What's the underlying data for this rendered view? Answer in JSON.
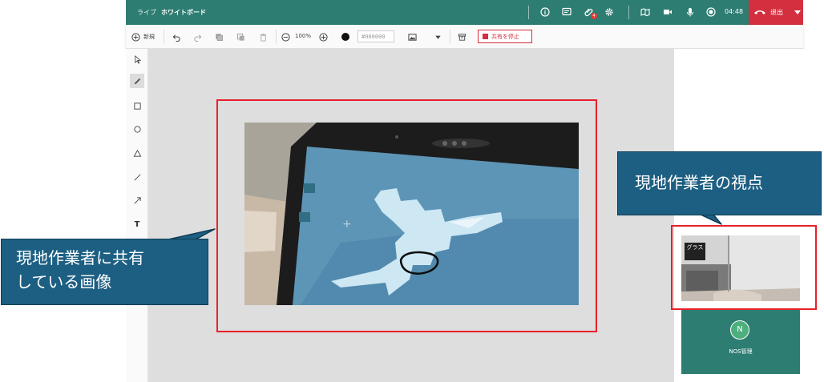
{
  "topbar": {
    "live_label": "ライブ",
    "whiteboard_label": "ホワイトボード",
    "badge_count": "4",
    "time": "04:48",
    "leave_label": "退出",
    "bg_color": "#2e7d72",
    "leave_color": "#d32f3f",
    "icons": [
      "info-icon",
      "chat-icon",
      "attachment-icon",
      "settings-icon",
      "map-icon",
      "video-icon",
      "microphone-icon",
      "record-icon",
      "hangup-icon",
      "chevron-down-icon"
    ]
  },
  "toolbar": {
    "new_label": "新規",
    "zoom_label": "100%",
    "color_value": "#000000",
    "stop_share_label": "共有を停止",
    "icons": [
      "add-circle-icon",
      "undo-icon",
      "redo-icon",
      "copy-icon",
      "duplicate-icon",
      "delete-icon",
      "zoom-out-icon",
      "zoom-in-icon",
      "image-icon",
      "caret-down-icon",
      "archive-icon"
    ]
  },
  "palette": {
    "text_tool_label": "T",
    "icons": [
      "select-cursor-icon",
      "pen-icon",
      "rectangle-icon",
      "circle-icon",
      "triangle-icon",
      "line-icon",
      "arrow-icon",
      "text-icon"
    ]
  },
  "right_panel": {
    "camera_label": "グラス",
    "user_initial": "N",
    "user_name": "NOS管理"
  },
  "annotations": {
    "shared_image_callout_line1": "現地作業者に共有",
    "shared_image_callout_line2": "している画像",
    "viewpoint_callout": "現地作業者の視点",
    "callout_color": "#1d5f82",
    "highlight_color": "#e8202a"
  }
}
